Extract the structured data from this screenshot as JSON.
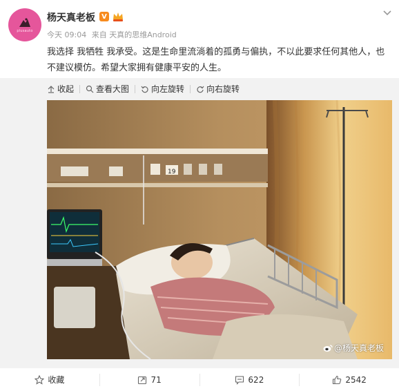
{
  "post": {
    "author": "杨天真老板",
    "verified_badge": "V",
    "avatar_text": "plusauto",
    "time": "今天 09:04",
    "source": "来自 天真的思维Android",
    "text": "我选择 我牺牲 我承受。这是生命里流淌着的孤勇与偏执，不以此要求任何其他人，也不建议模仿。希望大家拥有健康平安的人生。"
  },
  "toolbar": {
    "collapse": "收起",
    "view_large": "查看大图",
    "rotate_left": "向左旋转",
    "rotate_right": "向右旋转"
  },
  "photo": {
    "watermark": "@杨天真老板",
    "room_label": "19",
    "sign_text": "请勿随意调节"
  },
  "footer": {
    "favorite": "收藏",
    "repost_count": "71",
    "comment_count": "622",
    "like_count": "2542"
  },
  "colors": {
    "avatar_bg": "#e5569b",
    "vbadge": "#f78b1e",
    "meta_gray": "#999999"
  }
}
